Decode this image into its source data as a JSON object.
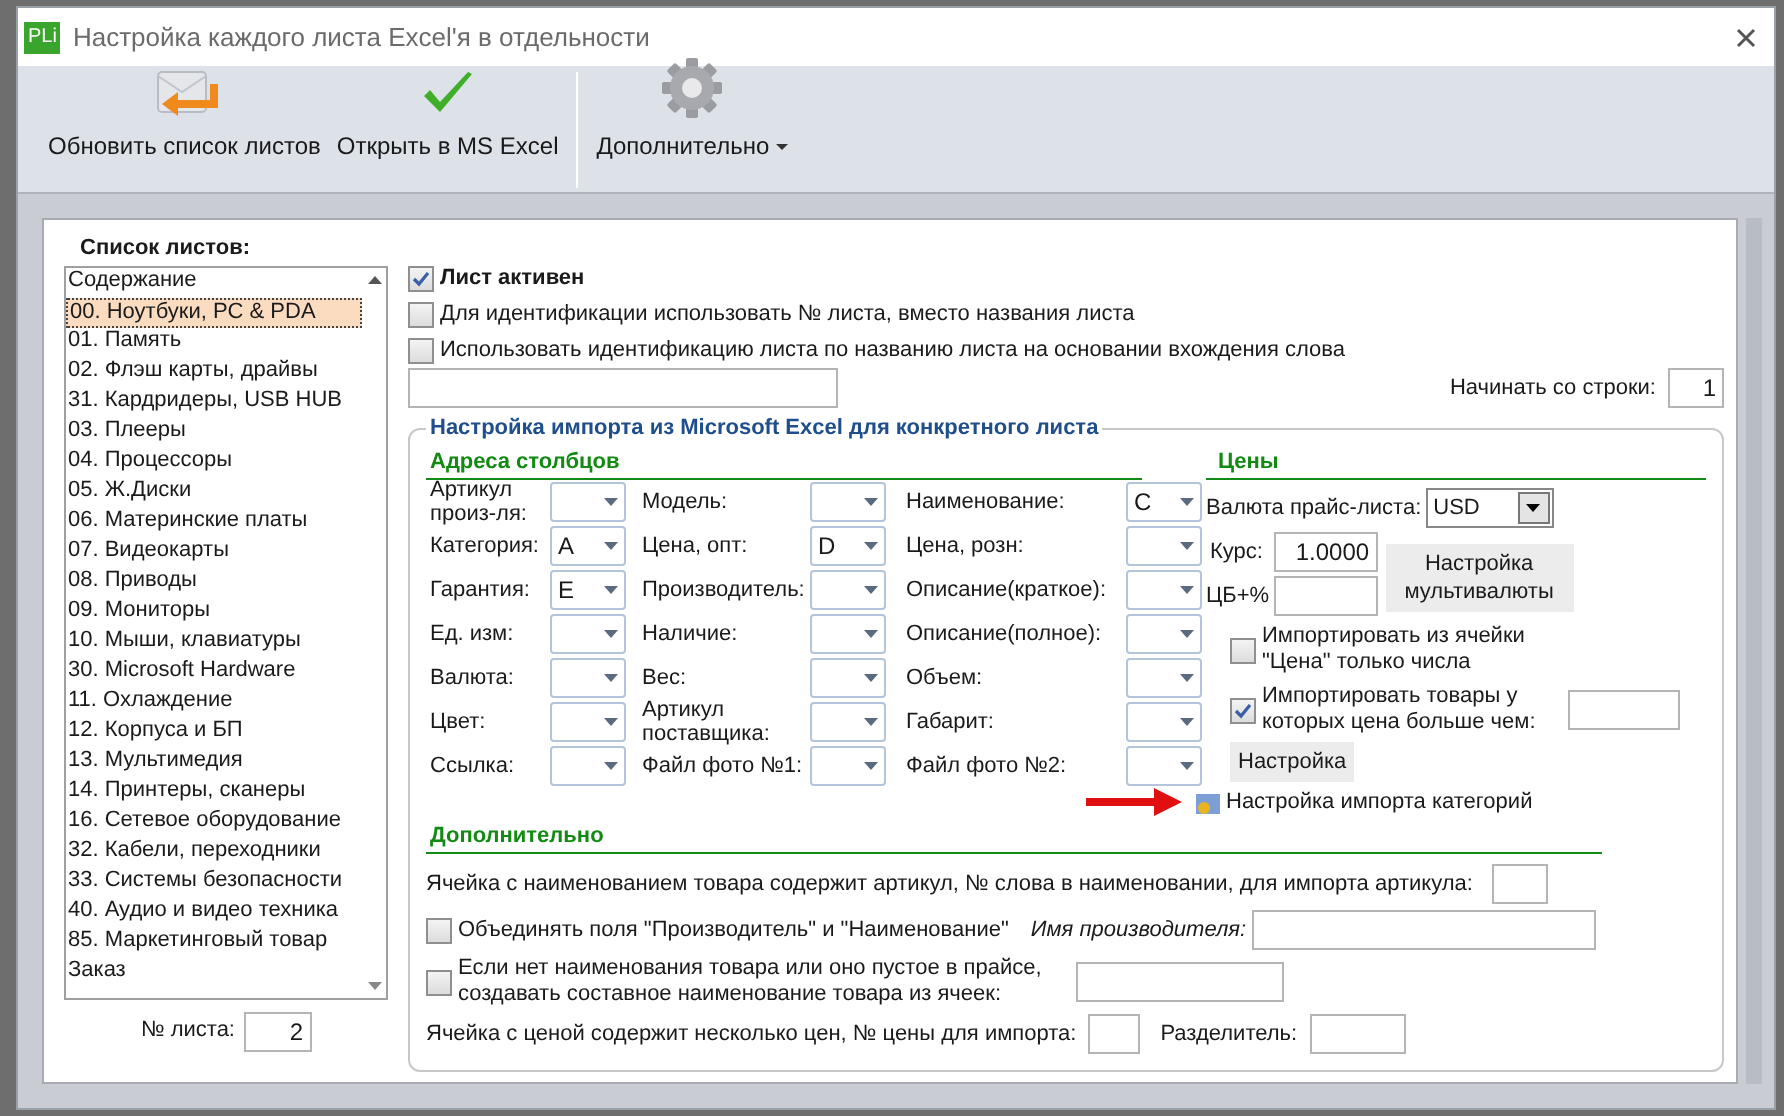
{
  "window": {
    "title": "Настройка каждого листа Excel'я в отдельности",
    "app_badge": "PLi"
  },
  "toolbar": [
    {
      "label": "Обновить список листов",
      "kind": "refresh",
      "dropdown": false
    },
    {
      "label": "Открыть в MS Excel",
      "kind": "check",
      "dropdown": false
    },
    {
      "label": "Дополнительно",
      "kind": "gear",
      "dropdown": true
    }
  ],
  "sheets": {
    "title": "Список листов:",
    "items": [
      {
        "label": "Содержание",
        "selected": false
      },
      {
        "label": "00. Ноутбуки, PC & PDA",
        "selected": true
      },
      {
        "label": "01. Память",
        "selected": false
      },
      {
        "label": "02. Флэш карты, драйвы",
        "selected": false
      },
      {
        "label": "31. Кардридеры, USB HUB",
        "selected": false
      },
      {
        "label": "03. Плееры",
        "selected": false
      },
      {
        "label": "04. Процессоры",
        "selected": false
      },
      {
        "label": "05. Ж.Диски",
        "selected": false
      },
      {
        "label": "06. Материнские платы",
        "selected": false
      },
      {
        "label": "07. Видеокарты",
        "selected": false
      },
      {
        "label": "08. Приводы",
        "selected": false
      },
      {
        "label": "09. Мониторы",
        "selected": false
      },
      {
        "label": "10. Мыши, клавиатуры",
        "selected": false
      },
      {
        "label": "30. Microsoft Hardware",
        "selected": false
      },
      {
        "label": "11. Охлаждение",
        "selected": false
      },
      {
        "label": "12. Корпуса и БП",
        "selected": false
      },
      {
        "label": "13. Мультимедия",
        "selected": false
      },
      {
        "label": "14. Принтеры, сканеры",
        "selected": false
      },
      {
        "label": "16. Сетевое оборудование",
        "selected": false
      },
      {
        "label": "32. Кабели, переходники",
        "selected": false
      },
      {
        "label": "33. Системы безопасности",
        "selected": false
      },
      {
        "label": "40. Аудио и видео техника",
        "selected": false
      },
      {
        "label": "85. Маркетинговый товар",
        "selected": false
      },
      {
        "label": "Заказ",
        "selected": false
      }
    ],
    "number_label": "№ листа:",
    "number": "2"
  },
  "options": [
    {
      "label": "Лист активен",
      "checked": true,
      "bold": true
    },
    {
      "label": "Для идентификации использовать № листа, вместо названия листа",
      "checked": false,
      "bold": false
    },
    {
      "label": "Использовать идентификацию листа по названию листа на основании вхождения слова",
      "checked": false,
      "bold": false
    }
  ],
  "start_row": {
    "label": "Начинать со строки:",
    "value": "1"
  },
  "import_group": {
    "title": "Настройка импорта из Microsoft Excel для конкретного листа",
    "addresses": {
      "title": "Адреса столбцов",
      "fields": [
        {
          "label": "Артикул произ-ля:"
        },
        {
          "label": "Модель:"
        },
        {
          "label": "Наименование:",
          "value": "C"
        },
        {
          "label": "Категория:",
          "value": "A"
        },
        {
          "label": "Цена, опт:",
          "value": "D"
        },
        {
          "label": "Цена, розн:"
        },
        {
          "label": "Гарантия:",
          "value": "E"
        },
        {
          "label": "Производитель:"
        },
        {
          "label": "Описание(краткое):"
        },
        {
          "label": "Ед. изм:"
        },
        {
          "label": "Наличие:"
        },
        {
          "label": "Описание(полное):"
        },
        {
          "label": "Валюта:"
        },
        {
          "label": "Вес:"
        },
        {
          "label": "Объем:"
        },
        {
          "label": "Цвет:"
        },
        {
          "label": "Артикул поставщика:"
        },
        {
          "label": "Габарит:"
        },
        {
          "label": "Ссылка:"
        },
        {
          "label": "Файл фото №1:"
        },
        {
          "label": "Файл фото №2:"
        }
      ]
    },
    "prices": {
      "title": "Цены",
      "currency_label": "Валюта прайс-листа:",
      "currency": "USD",
      "rate_label": "Курс:",
      "rate": "1.0000",
      "cb_label": "ЦБ+%",
      "multicurrency_button": "Настройка мультивалюты",
      "checks": [
        {
          "label": "Импортировать из ячейки \"Цена\" только числа",
          "checked": false,
          "has_field": false
        },
        {
          "label": "Импортировать товары у которых цена больше чем:",
          "checked": true,
          "has_field": true
        }
      ],
      "settings_button": "Настройка",
      "categories_link": "Настройка импорта категорий"
    },
    "extra": {
      "title": "Дополнительно",
      "article_label": "Ячейка с наименованием товара содержит артикул, № слова в наименовании, для импорта артикула:",
      "merge": {
        "label": "Объединять поля \"Производитель\" и \"Наименование\"",
        "checked": false,
        "name_label": "Имя производителя:"
      },
      "compose": {
        "label": "Если нет наименования товара или оно пустое в прайсе, создавать составное наименование товара из ячеек:",
        "checked": false
      },
      "multi_price_label": "Ячейка с ценой содержит несколько цен, № цены для импорта:",
      "separator_label": "Разделитель:"
    }
  }
}
